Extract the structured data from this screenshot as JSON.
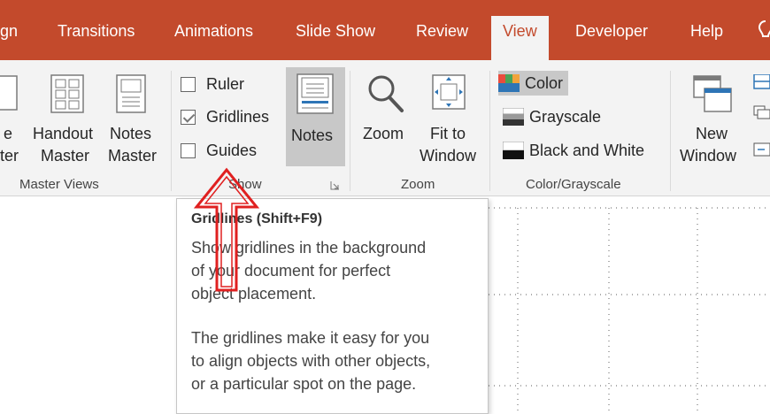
{
  "tabs": [
    {
      "label": "gn",
      "active": false
    },
    {
      "label": "Transitions",
      "active": false
    },
    {
      "label": "Animations",
      "active": false
    },
    {
      "label": "Slide Show",
      "active": false
    },
    {
      "label": "Review",
      "active": false
    },
    {
      "label": "View",
      "active": true
    },
    {
      "label": "Developer",
      "active": false
    },
    {
      "label": "Help",
      "active": false
    }
  ],
  "groups": {
    "master_views": {
      "label": "Master Views",
      "slide_master": {
        "line1": "e",
        "line2": "ter"
      },
      "handout_master": {
        "line1": "Handout",
        "line2": "Master"
      },
      "notes_master": {
        "line1": "Notes",
        "line2": "Master"
      }
    },
    "show": {
      "label": "Show",
      "ruler": {
        "label": "Ruler",
        "checked": false
      },
      "gridlines": {
        "label": "Gridlines",
        "checked": true
      },
      "guides": {
        "label": "Guides",
        "checked": false
      },
      "notes": {
        "label": "Notes"
      }
    },
    "zoom": {
      "label": "Zoom",
      "zoom_button": {
        "label": "Zoom"
      },
      "fit_to_window": {
        "line1": "Fit to",
        "line2": "Window"
      }
    },
    "color_grayscale": {
      "label": "Color/Grayscale",
      "color": {
        "label": "Color"
      },
      "grayscale": {
        "label": "Grayscale"
      },
      "black_and_white": {
        "label": "Black and White"
      }
    },
    "window": {
      "new_window": {
        "line1": "New",
        "line2": "Window"
      }
    }
  },
  "tooltip": {
    "title": "Gridlines (Shift+F9)",
    "paragraph1": [
      "Show gridlines in the background",
      "of your document for perfect",
      "object placement."
    ],
    "paragraph2": [
      "The gridlines make it easy for you",
      "to align objects with other objects,",
      "or a particular spot on the page."
    ]
  },
  "colors": {
    "tab_bar": "#c34a2c",
    "ribbon": "#f3f3f3",
    "selected": "#c8c8c8",
    "annotation_arrow": "#e02020",
    "icon_blue": "#2e75b6"
  }
}
